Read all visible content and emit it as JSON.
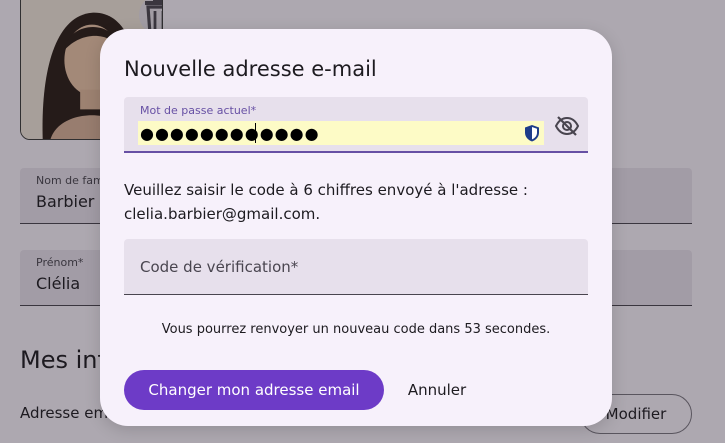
{
  "background": {
    "last_name_field": {
      "label": "Nom de fam",
      "value": "Barbier"
    },
    "first_name_field": {
      "label": "Prénom*",
      "value": "Clélia"
    },
    "section_title": "Mes inf",
    "email_label": "Adresse em",
    "modify_button_label": "Modifier",
    "icons": {
      "delete_photo": "trash-icon"
    }
  },
  "dialog": {
    "title": "Nouvelle adresse e-mail",
    "password_field": {
      "label": "Mot de passe actuel*",
      "value": "●●●●●●●●●●●●",
      "icons": {
        "manager": "shield-icon",
        "toggle": "eye-off-icon"
      }
    },
    "instruction_line1": "Veuillez saisir le code à 6 chiffres envoyé à l'adresse :",
    "instruction_line2": "clelia.barbier@gmail.com.",
    "code_field": {
      "placeholder": "Code de vérification*",
      "value": ""
    },
    "resend_note": "Vous pourrez renvoyer un nouveau code dans 53 secondes.",
    "submit_label": "Changer mon adresse email",
    "cancel_label": "Annuler"
  },
  "colors": {
    "primary": "#6d3bc7",
    "field_bg": "#e7e0ec",
    "autofill_bg": "#fdfbc6",
    "dialog_bg": "#f7f1fb"
  }
}
